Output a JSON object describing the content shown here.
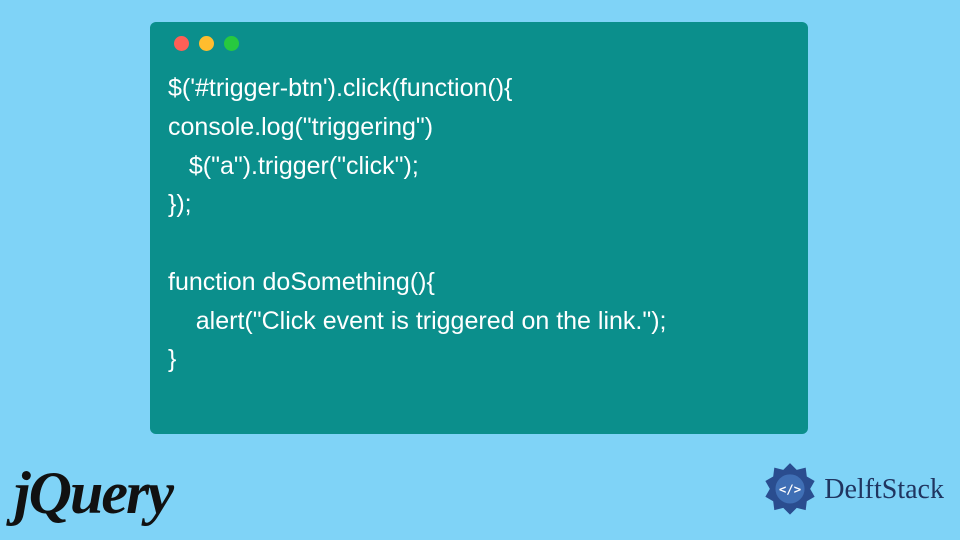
{
  "code_window": {
    "dots": [
      "red",
      "yellow",
      "green"
    ],
    "lines": [
      "$('#trigger-btn').click(function(){",
      "console.log(\"triggering\")",
      "   $(\"a\").trigger(\"click\");",
      "});",
      "",
      "function doSomething(){",
      "    alert(\"Click event is triggered on the link.\");",
      "}"
    ]
  },
  "branding": {
    "jquery_label": "jQuery",
    "delft_label": "DelftStack"
  },
  "colors": {
    "background": "#7fd3f7",
    "code_bg": "#0b8f8c",
    "code_text": "#ffffff",
    "dot_red": "#ff5f56",
    "dot_yellow": "#ffbd2e",
    "dot_green": "#27c93f",
    "brand_dark": "#203560"
  }
}
